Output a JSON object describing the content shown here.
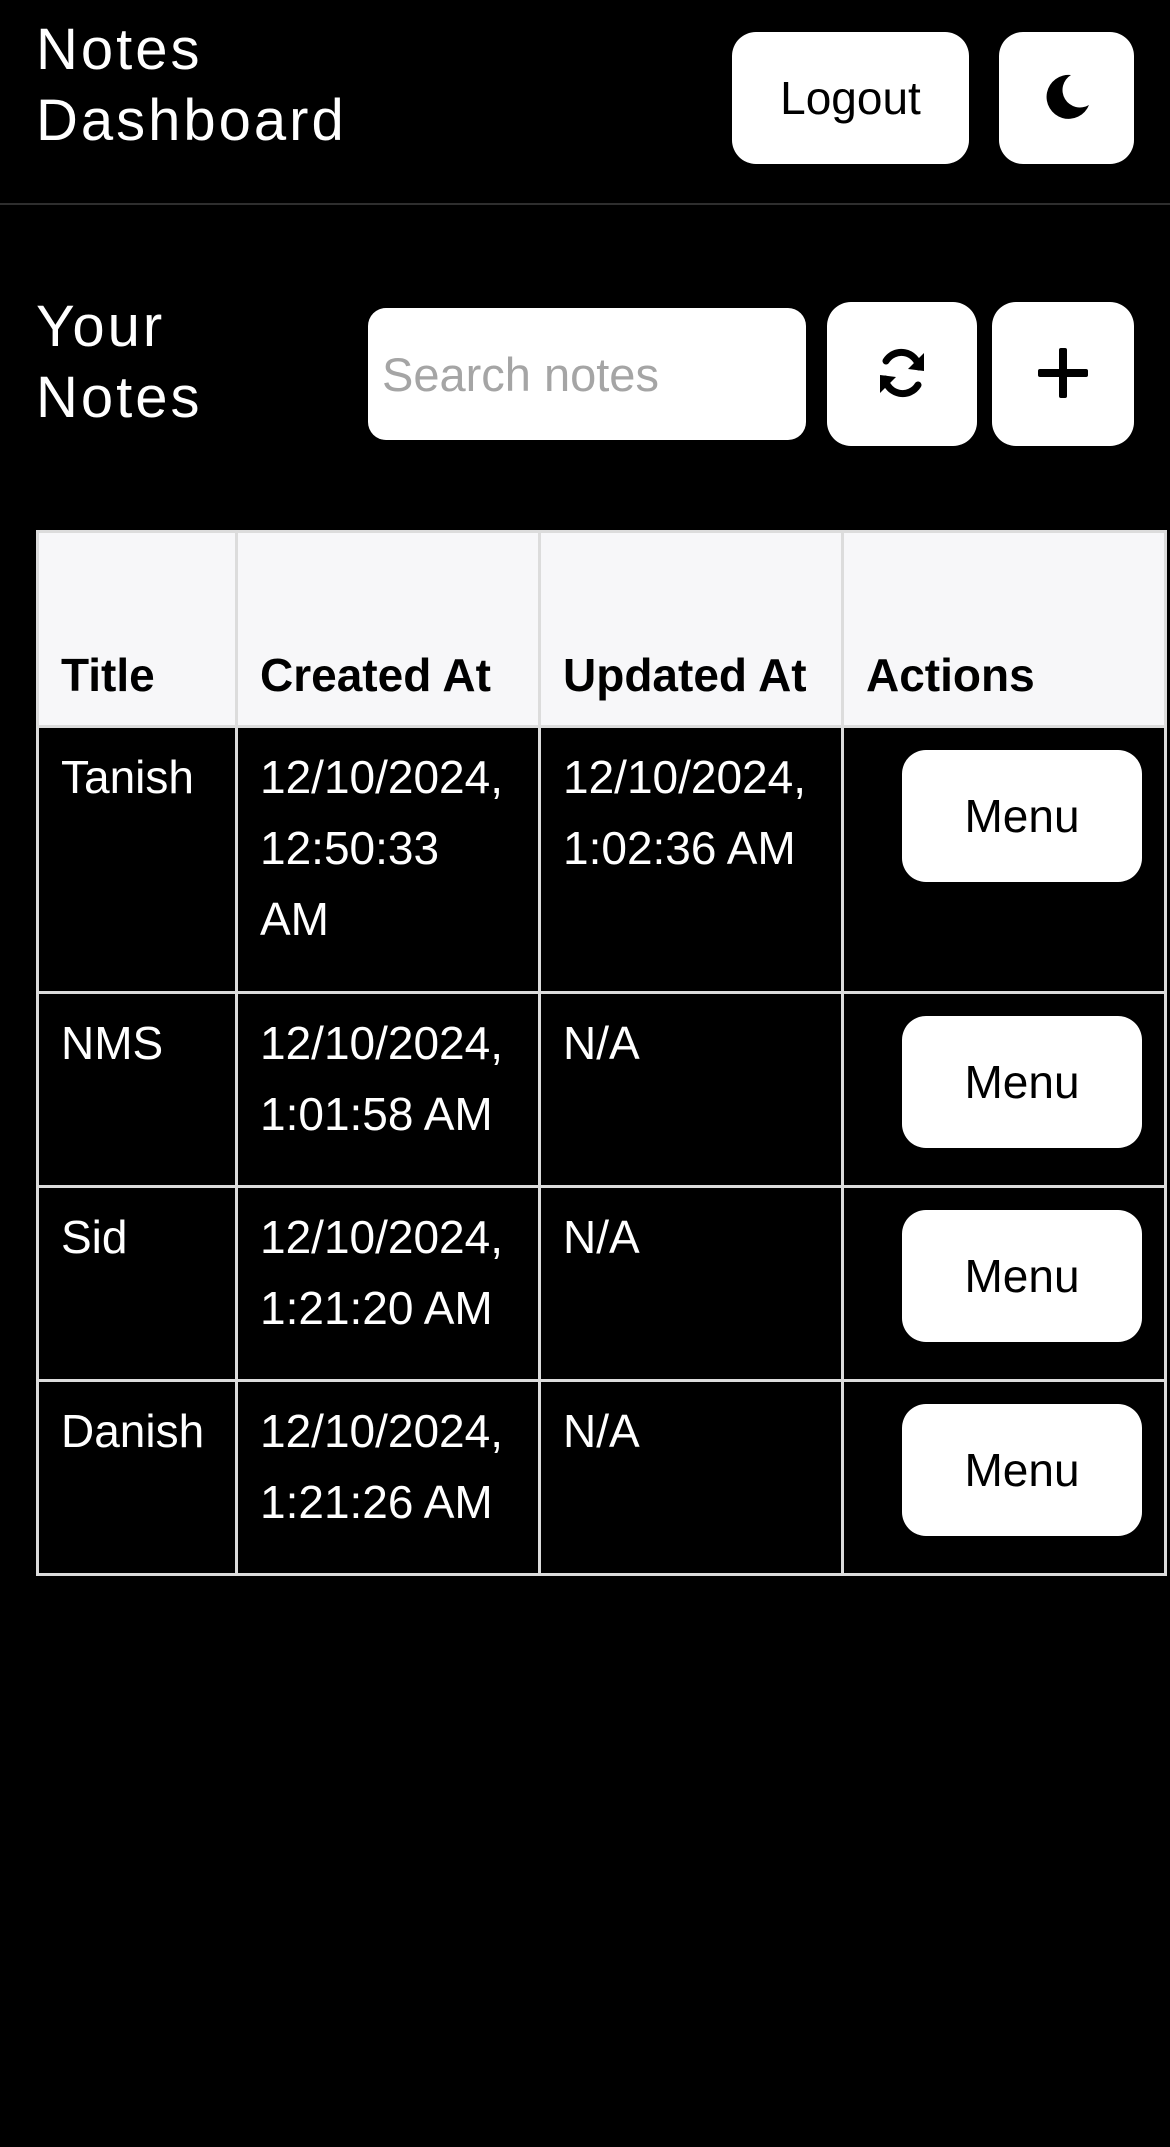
{
  "header": {
    "title": "Notes Dashboard",
    "logout_label": "Logout",
    "theme_icon": "moon-icon"
  },
  "toolbar": {
    "section_title": "Your Notes",
    "search_placeholder": "Search notes",
    "search_value": "",
    "refresh_icon": "refresh-icon",
    "add_icon": "plus-icon"
  },
  "table": {
    "columns": [
      "Title",
      "Created At",
      "Updated At",
      "Actions"
    ],
    "rows": [
      {
        "title": "Tanish",
        "created_at": "12/10/2024, 12:50:33 AM",
        "updated_at": "12/10/2024, 1:02:36 AM",
        "action_label": "Menu"
      },
      {
        "title": "NMS",
        "created_at": "12/10/2024, 1:01:58 AM",
        "updated_at": "N/A",
        "action_label": "Menu"
      },
      {
        "title": "Sid",
        "created_at": "12/10/2024, 1:21:20 AM",
        "updated_at": "N/A",
        "action_label": "Menu"
      },
      {
        "title": "Danish",
        "created_at": "12/10/2024, 1:21:26 AM",
        "updated_at": "N/A",
        "action_label": "Menu"
      }
    ]
  },
  "colors": {
    "background": "#000000",
    "header_row_bg": "#f7f7f9",
    "button_bg": "#ffffff",
    "border": "#dcdcdc"
  }
}
